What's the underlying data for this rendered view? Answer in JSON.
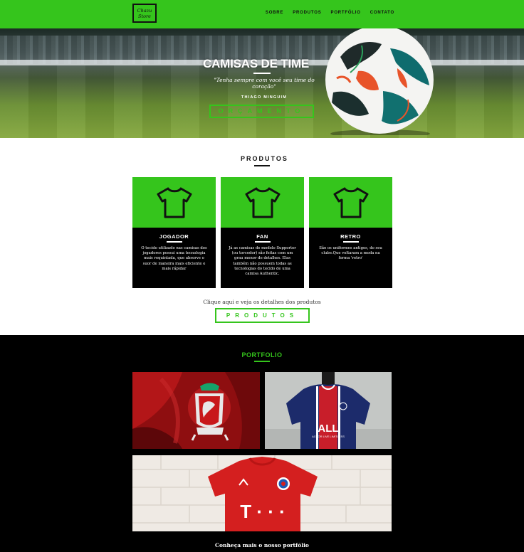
{
  "brand": {
    "logo_line1": "Chazu",
    "logo_line2": "Store"
  },
  "nav": {
    "items": [
      "SOBRE",
      "PRODUTOS",
      "PORTFÓLIO",
      "CONTATO"
    ]
  },
  "hero": {
    "title": "CAMISAS DE TIME",
    "quote": "\"Tenha sempre com você seu time do coração\"",
    "author": "THIAGO MINGUIM",
    "button": "ORÇAMENTO"
  },
  "products": {
    "title": "PRODUTOS",
    "cards": [
      {
        "name": "JOGADOR",
        "icon": "shirt-icon",
        "text": "O tecido utilizado nas camisas dos jogadores possui uma tecnologia mais requintada, que absorve o suor de maneira mais eficiente e mais rápidar"
      },
      {
        "name": "FAN",
        "icon": "shirt-icon",
        "text": "Já as camisas de modelo Supporter (ou torcedor) são feitas com um grau menor de detalhes. Elas também não possuem todas as tecnologias do tecido de uma camisa Authentic."
      },
      {
        "name": "RETRO",
        "icon": "shirt-icon",
        "text": "São os uniformes antigos, do seu clube.Que voltaram a moda na forma 'retro'"
      }
    ],
    "hint": "Clique aqui e veja os detalhes dos produtos",
    "button": "PRODUTOS"
  },
  "portfolio": {
    "title": "PORTFOLIO",
    "more": "Conheça mais o nosso portfólio",
    "photo_texts": {
      "psg_sponsor": "ALL",
      "psg_sub": "ACCOR LIVE LIMITLESS",
      "bayern_sponsor": "T · · ·"
    }
  },
  "colors": {
    "accent": "#35c51c",
    "dark": "#000000",
    "light": "#ffffff"
  }
}
